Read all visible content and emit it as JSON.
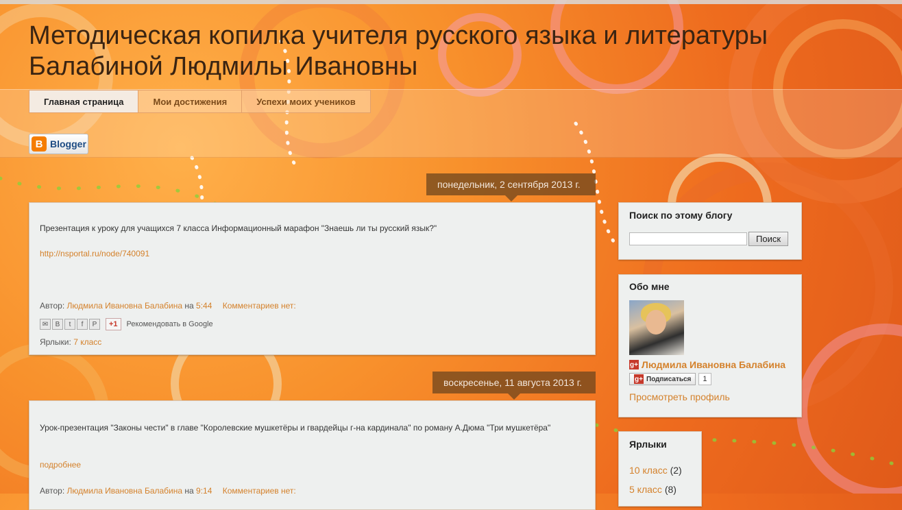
{
  "blog": {
    "title_line1": "Методическая копилка учителя русского языка и литературы",
    "title_line2": "Балабиной Людмилы Ивановны"
  },
  "nav": {
    "tabs": [
      {
        "label": "Главная страница",
        "active": true
      },
      {
        "label": "Мои достижения",
        "active": false
      },
      {
        "label": "Успехи моих учеников",
        "active": false
      }
    ]
  },
  "badge": {
    "icon": "blogger-icon",
    "label": "Blogger"
  },
  "posts": [
    {
      "date": "понедельник, 2 сентября 2013 г.",
      "body": "Презентация к уроку для учащихся 7 класса Информационный марафон \"Знаешь ли ты русский язык?\"",
      "link": "http://nsportal.ru/node/740091",
      "author_prefix": "Автор:",
      "author": "Людмила Ивановна Балабина",
      "at": "на",
      "time": "5:44",
      "comments": "Комментариев нет:",
      "share_icons": [
        "email-icon",
        "blogger-icon",
        "twitter-icon",
        "facebook-icon",
        "pinterest-icon"
      ],
      "gplus_label": "+1",
      "recommend": "Рекомендовать в Google",
      "labels_prefix": "Ярлыки:",
      "label": "7 класс"
    },
    {
      "date": "воскресенье, 11 августа 2013 г.",
      "body": "Урок-презентация \"Законы чести\" в главе \"Королевские мушкетёры и гвардейцы г-на кардинала\" по роману А.Дюма \"Три мушкетёра\"",
      "link": "подробнее",
      "author_prefix": "Автор:",
      "author": "Людмила Ивановна Балабина",
      "at": "на",
      "time": "9:14",
      "comments": "Комментариев нет:"
    }
  ],
  "sidebar": {
    "search": {
      "title": "Поиск по этому блогу",
      "button": "Поиск",
      "value": ""
    },
    "about": {
      "title": "Обо мне",
      "name": "Людмила Ивановна Балабина",
      "subscribe_label": "Подписаться",
      "subscribe_count": "1",
      "profile_link": "Просмотреть профиль"
    },
    "labels": {
      "title": "Ярлыки",
      "items": [
        {
          "label": "10 класс",
          "count": "(2)"
        },
        {
          "label": "5 класс",
          "count": "(8)"
        }
      ]
    }
  },
  "colors": {
    "accent": "#d4812b",
    "background": "#f8912c",
    "post_bg": "#eef0ef",
    "date_tab": "#6e461e"
  }
}
